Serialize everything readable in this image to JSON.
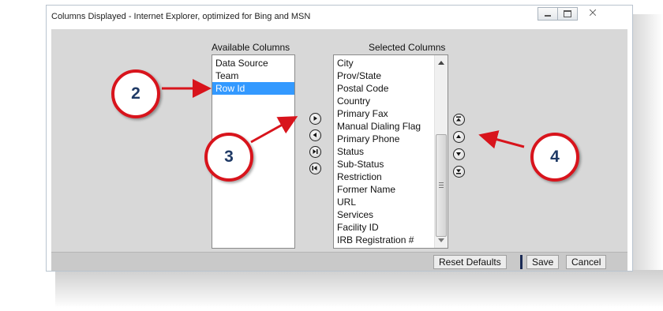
{
  "window": {
    "title": "Columns Displayed - Internet Explorer, optimized for Bing and MSN",
    "controls": [
      "minimize-icon",
      "maximize-icon",
      "close-icon"
    ],
    "close_glyph": "ⵔ"
  },
  "available": {
    "header": "Available Columns",
    "items": [
      "Data Source",
      "Team",
      "Row Id"
    ],
    "selected_item": "Row Id"
  },
  "selected": {
    "header": "Selected Columns",
    "items": [
      "City",
      "Prov/State",
      "Postal Code",
      "Country",
      "Primary Fax",
      "Manual Dialing Flag",
      "Primary Phone",
      "Status",
      "Sub-Status",
      "Restriction",
      "Former Name",
      "URL",
      "Services",
      "Facility ID",
      "IRB Registration #"
    ]
  },
  "transfer_buttons": [
    "add-icon",
    "remove-icon",
    "add-all-icon",
    "remove-all-icon"
  ],
  "order_buttons": [
    "move-top-icon",
    "move-up-icon",
    "move-down-icon",
    "move-bottom-icon"
  ],
  "footer": {
    "reset_label": "Reset Defaults",
    "save_label": "Save",
    "cancel_label": "Cancel"
  },
  "callouts": {
    "two": "2",
    "three": "3",
    "four": "4"
  },
  "colors": {
    "callout_red": "#d8141c",
    "callout_number": "#1f3a66",
    "selection_blue": "#3399ff"
  }
}
